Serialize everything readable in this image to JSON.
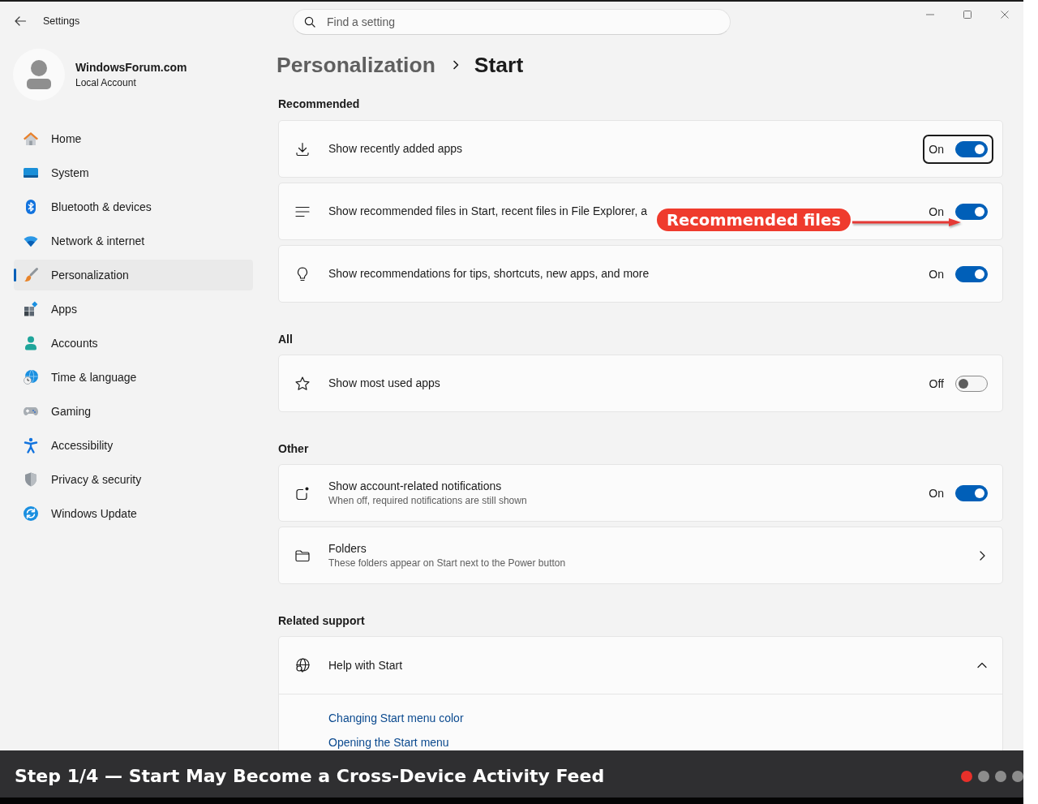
{
  "window": {
    "title": "Settings"
  },
  "account": {
    "name": "WindowsForum.com",
    "type": "Local Account"
  },
  "sidebar": {
    "items": [
      {
        "label": "Home",
        "selected": false
      },
      {
        "label": "System",
        "selected": false
      },
      {
        "label": "Bluetooth & devices",
        "selected": false
      },
      {
        "label": "Network & internet",
        "selected": false
      },
      {
        "label": "Personalization",
        "selected": true
      },
      {
        "label": "Apps",
        "selected": false
      },
      {
        "label": "Accounts",
        "selected": false
      },
      {
        "label": "Time & language",
        "selected": false
      },
      {
        "label": "Gaming",
        "selected": false
      },
      {
        "label": "Accessibility",
        "selected": false
      },
      {
        "label": "Privacy & security",
        "selected": false
      },
      {
        "label": "Windows Update",
        "selected": false
      }
    ]
  },
  "search": {
    "placeholder": "Find a setting"
  },
  "breadcrumb": {
    "parent": "Personalization",
    "current": "Start"
  },
  "sections": [
    {
      "heading": "Recommended",
      "items": [
        {
          "kind": "toggle",
          "label": "Show recently added apps",
          "state_label": "On",
          "on": true,
          "focused": true
        },
        {
          "kind": "toggle",
          "label": "Show recommended files in Start, recent files in File Explorer, a",
          "state_label": "On",
          "on": true,
          "focused": false,
          "callout": "Recommended files"
        },
        {
          "kind": "toggle",
          "label": "Show recommendations for tips, shortcuts, new apps, and more",
          "state_label": "On",
          "on": true,
          "focused": false
        }
      ]
    },
    {
      "heading": "All",
      "items": [
        {
          "kind": "toggle",
          "label": "Show most used apps",
          "state_label": "Off",
          "on": false,
          "focused": false
        }
      ]
    },
    {
      "heading": "Other",
      "items": [
        {
          "kind": "toggle",
          "label": "Show account-related notifications",
          "description": "When off, required notifications are still shown",
          "state_label": "On",
          "on": true,
          "focused": false
        },
        {
          "kind": "link",
          "label": "Folders",
          "description": "These folders appear on Start next to the Power button"
        }
      ]
    },
    {
      "heading": "Related support",
      "items": [
        {
          "kind": "expander",
          "label": "Help with Start",
          "expanded": true,
          "links": [
            "Changing Start menu color",
            "Opening the Start menu"
          ]
        }
      ]
    }
  ],
  "caption_bar": {
    "text": "Step 1/4 — Start May Become a Cross-Device Activity Feed",
    "steps": [
      {
        "selected": true
      },
      {
        "selected": false
      },
      {
        "selected": false
      },
      {
        "selected": false
      }
    ]
  }
}
